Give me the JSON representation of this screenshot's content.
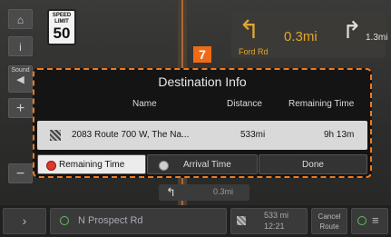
{
  "speed_sign": {
    "top": "SPEED",
    "mid": "LIMIT",
    "value": "50"
  },
  "turn_panel": {
    "next_distance": "0.3mi",
    "street": "Ford Rd",
    "second_distance": "1.3mi"
  },
  "marker": "7",
  "sidebar": {
    "home_icon": "⌂",
    "info_icon": "i",
    "sound_label": "Sound",
    "sound_icon": "◀",
    "zoom_in": "+",
    "zoom_out": "−"
  },
  "dialog": {
    "title": "Destination Info",
    "headers": {
      "name": "Name",
      "distance": "Distance",
      "remaining": "Remaining Time"
    },
    "row": {
      "name": "2083 Route 700 W, The Na...",
      "distance": "533mi",
      "remaining": "9h 13m"
    },
    "buttons": {
      "remaining": "Remaining Time",
      "arrival": "Arrival Time",
      "done": "Done"
    }
  },
  "mini_turn": {
    "distance": "0.3mi"
  },
  "bottom": {
    "street": "N Prospect Rd",
    "dest_distance": "533 mi",
    "dest_time": "12:21",
    "cancel_line1": "Cancel",
    "cancel_line2": "Route"
  },
  "colors": {
    "accent": "#ef6a16",
    "turn": "#e1a530",
    "radio_on": "#e0382b"
  }
}
